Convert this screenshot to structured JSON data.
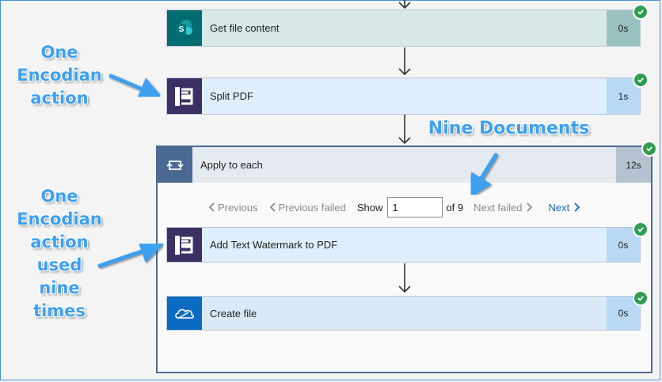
{
  "steps": {
    "get_file": {
      "title": "Get file content",
      "duration": "0s",
      "icon": "sharepoint-icon",
      "bar_color": "#d8e8e6",
      "dur_color": "#9ac2c0"
    },
    "split_pdf": {
      "title": "Split PDF",
      "duration": "1s",
      "icon": "encodian-icon",
      "bar_color": "#dfeefb",
      "dur_color": "#b9d8f4"
    },
    "apply_to_each": {
      "title": "Apply to each",
      "duration": "12s",
      "icon": "loop-icon",
      "bar_color": "#e5e9f0",
      "dur_color": "#b5c3d1"
    },
    "add_watermark": {
      "title": "Add Text Watermark to PDF",
      "duration": "0s",
      "icon": "encodian-icon"
    },
    "create_file": {
      "title": "Create file",
      "duration": "0s",
      "icon": "onedrive-icon"
    }
  },
  "pager": {
    "previous": "Previous",
    "previous_failed": "Previous failed",
    "show_label": "Show",
    "show_value": "1",
    "of_label": "of 9",
    "next_failed": "Next failed",
    "next": "Next"
  },
  "callouts": {
    "one_encodian_action": [
      "One",
      "Encodian",
      "action"
    ],
    "nine_documents": "Nine Documents",
    "one_encodian_nine_times": [
      "One",
      "Encodian",
      "action",
      "used",
      "nine",
      "times"
    ]
  },
  "colors": {
    "accent": "#3da0f0",
    "success": "#2e9e4f",
    "link": "#0f6cbd",
    "loop_header": "#4a6a94"
  }
}
